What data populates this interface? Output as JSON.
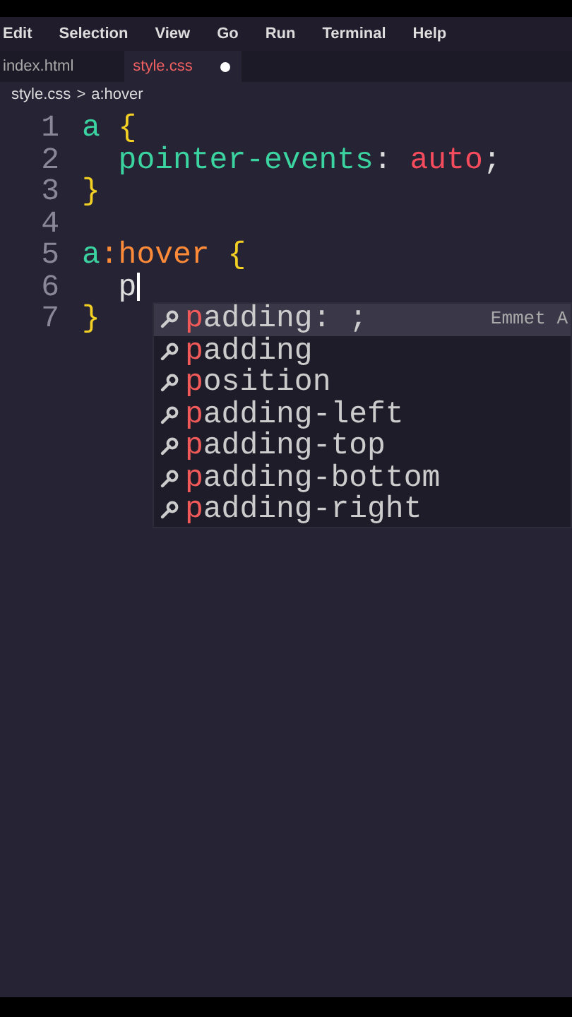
{
  "menu": [
    "Edit",
    "Selection",
    "View",
    "Go",
    "Run",
    "Terminal",
    "Help"
  ],
  "tabs": [
    {
      "label": "index.html",
      "selected": false,
      "modified": false
    },
    {
      "label": "style.css",
      "selected": true,
      "modified": true
    }
  ],
  "breadcrumb": {
    "items": [
      "style.css",
      "a:hover"
    ],
    "separator": ">"
  },
  "lines": [
    {
      "number": "1",
      "tokens": [
        {
          "kind": "selector",
          "text": "a"
        },
        {
          "kind": "open_brace",
          "text": "{"
        }
      ]
    },
    {
      "number": "2",
      "indented": true,
      "tokens": [
        {
          "kind": "property",
          "text": "pointer-events"
        },
        {
          "kind": "punct",
          "text": ":"
        },
        {
          "kind": "value",
          "text": "auto"
        },
        {
          "kind": "punct",
          "text": ";"
        }
      ]
    },
    {
      "number": "3",
      "tokens": [
        {
          "kind": "close_brace",
          "text": "}"
        }
      ]
    },
    {
      "number": "4"
    },
    {
      "number": "5",
      "tokens": [
        {
          "kind": "selector",
          "text": "a"
        },
        {
          "kind": "pseudo",
          "text": ":hover"
        },
        {
          "kind": "open_brace",
          "text": "{"
        }
      ]
    },
    {
      "number": "6",
      "indented": true,
      "tokens": [
        {
          "kind": "typed",
          "text": "p"
        }
      ],
      "cursor": true
    },
    {
      "number": "7",
      "tokens": [
        {
          "kind": "close_brace",
          "text": "}"
        }
      ]
    }
  ],
  "suggestions": [
    {
      "label": "padding: ;",
      "detail": "Emmet A",
      "selected": true
    },
    {
      "label": "padding",
      "selected": false
    },
    {
      "label": "position",
      "selected": false
    },
    {
      "label": "padding-left",
      "selected": false
    },
    {
      "label": "padding-top",
      "selected": false
    },
    {
      "label": "padding-bottom",
      "selected": false
    },
    {
      "label": "padding-right",
      "selected": false
    }
  ]
}
